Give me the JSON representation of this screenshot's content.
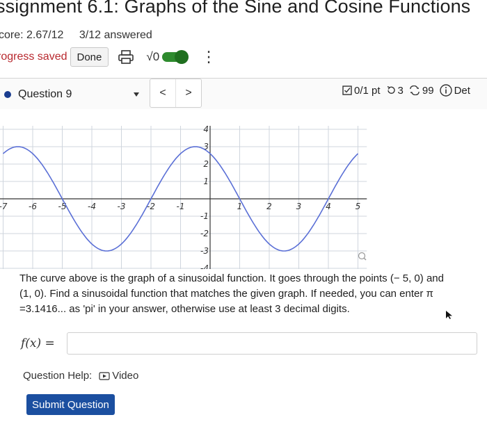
{
  "assignment": {
    "title": "ssignment 6.1: Graphs of the Sine and Cosine Functions",
    "score": "core: 2.67/12",
    "answered": "3/12 answered",
    "progress": "rogress saved",
    "done_label": "Done"
  },
  "toolbar": {
    "print_icon": "printer-icon",
    "math_toggle_label": "√0",
    "math_toggle_on": true,
    "menu_icon": "kebab-icon"
  },
  "question_nav": {
    "selected": "Question 9",
    "prev_icon": "<",
    "next_icon": ">",
    "points": "0/1 pt",
    "retries": "3",
    "attempts": "99",
    "details": "Det"
  },
  "graph": {
    "x_ticks": [
      "-7",
      "-6",
      "-5",
      "-4",
      "-3",
      "-2",
      "-1",
      "1",
      "2",
      "3",
      "4",
      "5"
    ],
    "y_ticks": [
      "4",
      "3",
      "2",
      "1",
      "-1",
      "-2",
      "-3",
      "-4"
    ],
    "curve_color": "#5a6fd6",
    "function_points": {
      "x_min": -7,
      "x_max": 5,
      "amplitude": 3,
      "period": 6,
      "phase_zero_at": -5
    }
  },
  "problem": {
    "text_1": "The curve above is the graph of a sinusoidal function. It goes through the points (− 5, 0) and",
    "text_2": "(1, 0). Find a sinusoidal function that matches the given graph. If needed, you can enter π",
    "text_3": "=3.1416... as 'pi' in your answer, otherwise use at least 3 decimal digits.",
    "answer_label": "f(x) =",
    "answer_value": ""
  },
  "help": {
    "label": "Question Help:",
    "video_label": "Video"
  },
  "submit_label": "Submit Question"
}
